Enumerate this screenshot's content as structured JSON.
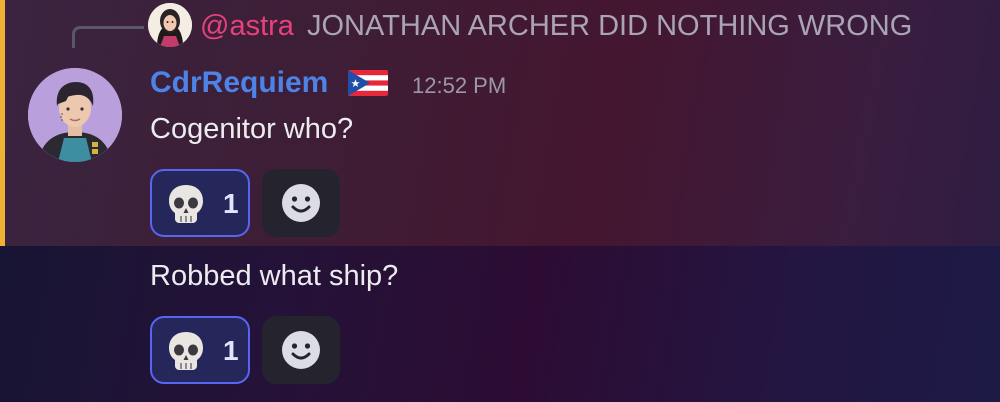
{
  "reply": {
    "author": "@astra",
    "text": "JONATHAN ARCHER DID NOTHING WRONG"
  },
  "message": {
    "author": "CdrRequiem",
    "flag": "puerto-rico-flag",
    "timestamp": "12:52 PM",
    "lines": [
      {
        "text": "Cogenitor who?",
        "reaction": {
          "emoji": "skull-emoji",
          "count": "1"
        }
      },
      {
        "text": "Robbed what ship?",
        "reaction": {
          "emoji": "skull-emoji",
          "count": "1"
        }
      }
    ]
  },
  "colors": {
    "mention_bar": "#f0b232",
    "author": "#4d82e6",
    "reply_author": "#e8417a",
    "reaction_border": "#5864f2"
  }
}
